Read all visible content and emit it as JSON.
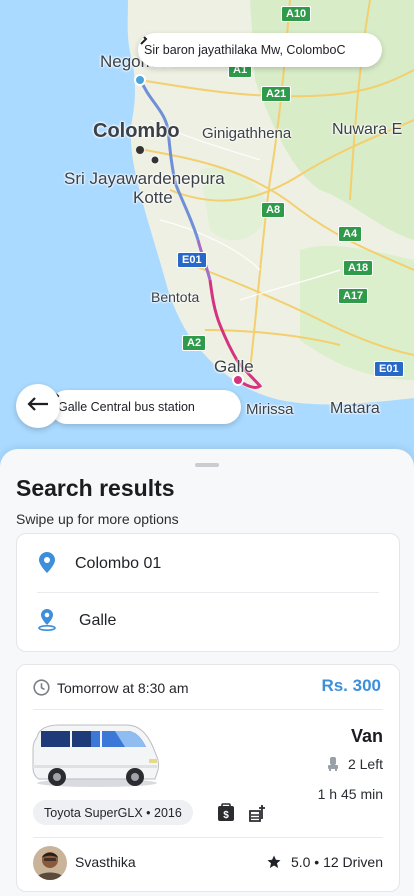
{
  "map": {
    "labels": {
      "negombo": "Negombo",
      "colombo": "Colombo",
      "sri_jaya": "Sri Jayawardenepura",
      "kotte": "Kotte",
      "ginigathhena": "Ginigathhena",
      "nuwara": "Nuwara E",
      "bentota": "Bentota",
      "galle": "Galle",
      "mirissa": "Mirissa",
      "matara": "Matara"
    },
    "shields": {
      "a10": "A10",
      "a1": "A1",
      "a21": "A21",
      "a8": "A8",
      "a4": "A4",
      "a18": "A18",
      "a17": "A17",
      "a2": "A2",
      "e01_a": "E01",
      "e01_b": "E01"
    },
    "colors": {
      "water": "#aadaff",
      "land": "#eef0e3",
      "route_blue": "#6f8fd6",
      "route_pink": "#d4337f"
    }
  },
  "start_pill": {
    "text": "Sir baron jayathilaka Mw, ColomboC",
    "icon": "chevron-right-icon"
  },
  "end_pill": {
    "text": "Galle Central bus station",
    "icon": "chevron-right-icon"
  },
  "back_button": {
    "icon": "arrow-left-icon"
  },
  "sheet": {
    "title": "Search results",
    "subtitle": "Swipe up for more options"
  },
  "route": {
    "from": "Colombo 01",
    "to": "Galle",
    "from_icon": "location-pin-icon",
    "to_icon": "location-marker-icon"
  },
  "ride": {
    "time": "Tomorrow at 8:30 am",
    "price": "Rs. 300",
    "vehicle_type": "Van",
    "seats_left": "2 Left",
    "duration": "1 h 45 min",
    "model": "Toyota SuperGLX • 2016",
    "facilities": [
      "cash-icon",
      "luggage-icon"
    ],
    "driver_name": "Svasthika",
    "rating": "5.0 • 12 Driven",
    "accent": "#3d8fd9"
  }
}
